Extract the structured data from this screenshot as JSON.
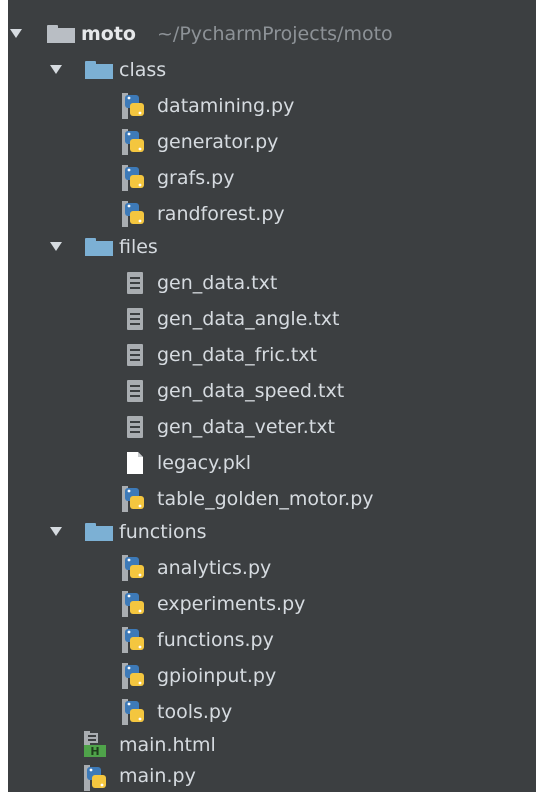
{
  "project": {
    "name": "moto",
    "path": "~/PycharmProjects/moto"
  },
  "folders": {
    "class": {
      "name": "class",
      "files": [
        "datamining.py",
        "generator.py",
        "grafs.py",
        "randforest.py"
      ]
    },
    "files": {
      "name": "files",
      "files": [
        "gen_data.txt",
        "gen_data_angle.txt",
        "gen_data_fric.txt",
        "gen_data_speed.txt",
        "gen_data_veter.txt",
        "legacy.pkl",
        "table_golden_motor.py"
      ]
    },
    "functions": {
      "name": "functions",
      "files": [
        "analytics.py",
        "experiments.py",
        "functions.py",
        "gpioinput.py",
        "tools.py"
      ]
    }
  },
  "root_files": [
    "main.html",
    "main.py"
  ],
  "colors": {
    "background": "#3c3f41",
    "text": "#d6dbe0",
    "path_text": "#8d9297",
    "folder": "#7cb0d4",
    "python_blue": "#3d7ab8",
    "python_yellow": "#f4c63f"
  }
}
